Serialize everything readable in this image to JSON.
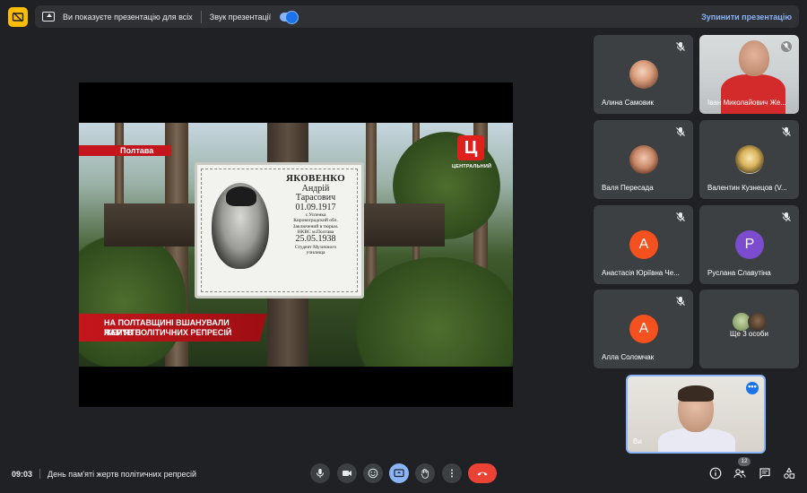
{
  "banner": {
    "presenting_text": "Ви показуєте презентацію для всіх",
    "sound_label": "Звук презентації",
    "stop_label": "Зупинити презентацію"
  },
  "presentation": {
    "city_label": "Полтава",
    "channel_logo": "Ц",
    "channel_name": "ЦЕНТРАЛЬНИЙ",
    "headline_line1": "НА ПОЛТАВЩИНІ ВШАНУВАЛИ ПАМ'ЯТЬ",
    "headline_line2": "ЖЕРТВ ПОЛІТИЧНИХ РЕПРЕСІЙ",
    "plaque": {
      "surname": "ЯКОВЕНКО",
      "first_name": "Андрій",
      "patronymic": "Тарасович",
      "birth_date": "01.09.1917",
      "line1": "с.Успенка",
      "line2": "Кировоградский обл.",
      "line3": "Заключений в тюрьм.",
      "line4": "НКВС м.Полтава",
      "death_date": "25.05.1938",
      "line5": "Студент Музичного",
      "line6": "училища"
    }
  },
  "participants": [
    {
      "name": "Алина Самовик",
      "type": "photo"
    },
    {
      "name": "Іван Миколайович Же...",
      "type": "video"
    },
    {
      "name": "Валя Пересада",
      "type": "photo"
    },
    {
      "name": "Валентин Кузнецов (V...",
      "type": "photo"
    },
    {
      "name": "Анастасія Юріївна Че...",
      "type": "initial",
      "initial": "А",
      "color": "#f4511e"
    },
    {
      "name": "Руслана Славутіна",
      "type": "initial",
      "initial": "Р",
      "color": "#7b4cce"
    },
    {
      "name": "Алла Соломчак",
      "type": "initial",
      "initial": "А",
      "color": "#f4511e"
    },
    {
      "name": "Ще 3 особи",
      "type": "more"
    }
  ],
  "self_view": {
    "name": "Ви"
  },
  "bottom": {
    "time": "09:03",
    "meeting_title": "День пам'яті жертв політичних репресій",
    "participant_count": "12"
  },
  "colors": {
    "background": "#202124",
    "tile": "#3c4043",
    "accent": "#8ab4f8",
    "end_call": "#ea4335",
    "logo": "#fbbc04"
  }
}
